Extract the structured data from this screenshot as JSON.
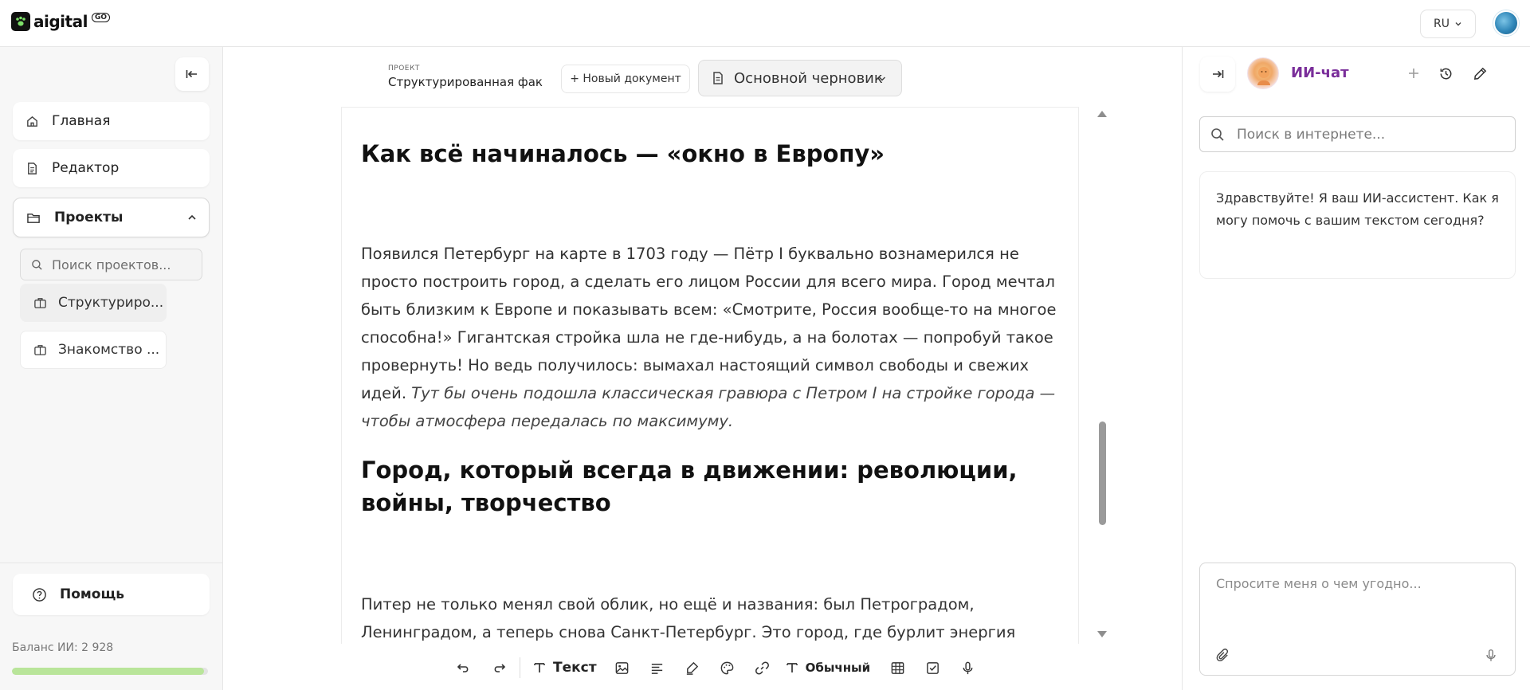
{
  "app": {
    "logo_text": "aigital",
    "logo_badge": "GO",
    "language": "RU"
  },
  "sidebar": {
    "nav": [
      {
        "label": "Главная",
        "icon": "home-icon"
      },
      {
        "label": "Редактор",
        "icon": "document-icon"
      },
      {
        "label": "Проекты",
        "icon": "folder-icon"
      }
    ],
    "project_search_placeholder": "Поиск проектов...",
    "projects": [
      {
        "label": "Структуриро...",
        "icon": "briefcase-icon",
        "active": true
      },
      {
        "label": "Знакомство ...",
        "icon": "briefcase-icon",
        "active": false
      }
    ],
    "help_label": "Помощь",
    "balance_label": "Баланс ИИ: 2 928",
    "balance_fraction": 0.98,
    "balance_color": "#b9e59a"
  },
  "editor": {
    "project_caption": "ПРОЕКТ",
    "project_name": "Структурированная факт-с",
    "new_doc_label": "+ Новый документ",
    "draft_label": "Основной черновик",
    "heading_1": "Как всё начиналось — «окно в Европу»",
    "paragraph_1": "Появился Петербург на карте в 1703 году — Пётр I буквально вознамерился не просто построить город, а сделать его лицом России для всего мира. Город мечтал быть близким к Европе и показывать всем: «Смотрите, Россия вообще-то на многое способна!» Гигантская стройка шла не где-нибудь, а на болотах — попробуй такое провернуть! Но ведь получилось: вымахал настоящий символ свободы и свежих идей.",
    "paragraph_1_italic": "Тут бы очень подошла классическая гравюра с Петром I на стройке города — чтобы атмосфера передалась по максимуму.",
    "heading_2": "Город, который всегда в движении: революции, войны, творчество",
    "paragraph_2": "Питер не только менял свой облик, но ещё и названия: был Петроградом, Ленинградом, а теперь снова Санкт-Петербург. Это город, где бурлит энергия перемен: тут случались"
  },
  "toolbar": {
    "text_label": "Текст",
    "style_label": "Обычный"
  },
  "chat": {
    "title": "ИИ-чат",
    "search_placeholder": "Поиск в интернете...",
    "greeting": "Здравствуйте! Я ваш ИИ-ассистент. Как я могу помочь с вашим текстом сегодня?",
    "input_placeholder": "Спросите меня о чем угодно..."
  }
}
